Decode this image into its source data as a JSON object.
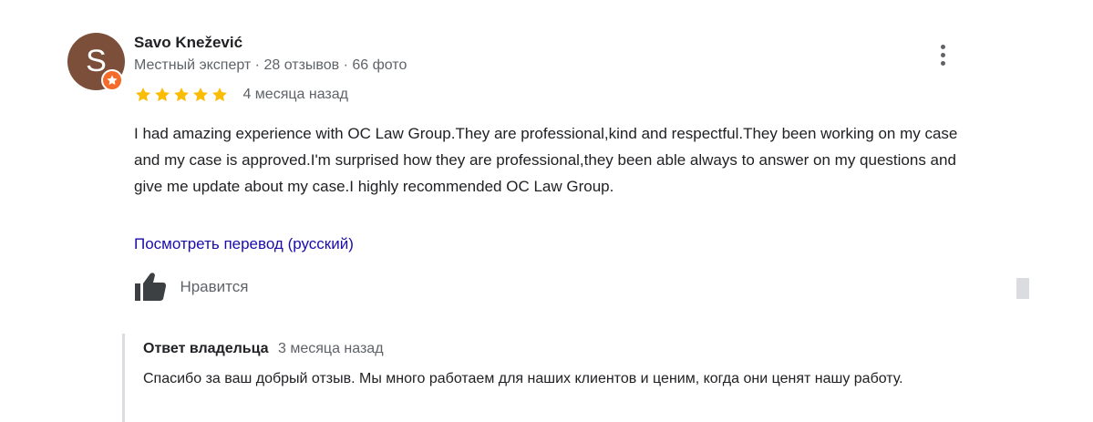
{
  "author": {
    "avatar_letter": "S",
    "avatar_color": "#7b4f3a",
    "badge_icon": "local-guide-star-icon",
    "badge_color": "#f36c2c",
    "name": "Savo Knežević",
    "meta": "Местный эксперт · 28 отзывов · 66 фото"
  },
  "review": {
    "rating": 5,
    "rating_max": 5,
    "star_color": "#fbbc04",
    "time_ago": "4 месяца назад",
    "text": "I had amazing experience with OC Law Group.They are professional,kind and respectful.They been working on my case and my case is approved.I'm surprised how they are professional,they been able always to answer on my questions and give me update about my case.I highly recommended OC Law Group.",
    "translate_link": "Посмотреть перевод (русский)",
    "like_label": "Нравится",
    "like_icon": "thumbs-up-icon",
    "more_icon": "more-vert-icon"
  },
  "owner_reply": {
    "title": "Ответ владельца",
    "time_ago": "3 месяца назад",
    "text": "Спасибо за ваш добрый отзыв. Мы много работаем для наших клиентов и ценим, когда они ценят нашу работу."
  }
}
